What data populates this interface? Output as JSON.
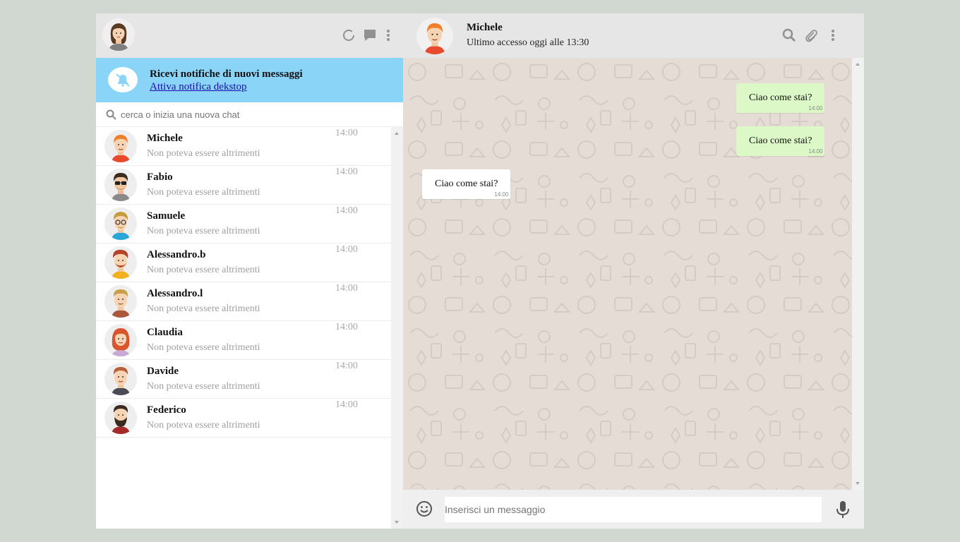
{
  "left_header": {
    "icons": [
      "status-icon",
      "new-chat-icon",
      "menu-icon"
    ]
  },
  "notification": {
    "title": "Ricevi notifiche di nuovi messaggi",
    "link": "Attiva notifica dekstop"
  },
  "search": {
    "placeholder": "cerca o inizia una nuova chat"
  },
  "chats": [
    {
      "name": "Michele",
      "preview": "Non poteva essere altrimenti",
      "time": "14:00"
    },
    {
      "name": "Fabio",
      "preview": "Non poteva essere altrimenti",
      "time": "14:00"
    },
    {
      "name": "Samuele",
      "preview": "Non poteva essere altrimenti",
      "time": "14:00"
    },
    {
      "name": "Alessandro.b",
      "preview": "Non poteva essere altrimenti",
      "time": "14:00"
    },
    {
      "name": "Alessandro.l",
      "preview": "Non poteva essere altrimenti",
      "time": "14:00"
    },
    {
      "name": "Claudia",
      "preview": "Non poteva essere altrimenti",
      "time": "14:00"
    },
    {
      "name": "Davide",
      "preview": "Non poteva essere altrimenti",
      "time": "14:00"
    },
    {
      "name": "Federico",
      "preview": "Non poteva essere altrimenti",
      "time": "14:00"
    }
  ],
  "conversation": {
    "contact_name": "Michele",
    "last_seen": "Ultimo accesso oggi alle 13:30",
    "header_icons": [
      "search-icon",
      "attach-icon",
      "menu-icon"
    ],
    "messages": [
      {
        "direction": "out",
        "text": "Ciao come stai?",
        "time": "14:00"
      },
      {
        "direction": "out",
        "text": "Ciao come stai?",
        "time": "14:00"
      },
      {
        "direction": "in",
        "text": "Ciao come stai?",
        "time": "14:00"
      }
    ]
  },
  "composer": {
    "placeholder": "Inserisci un messaggio"
  },
  "colors": {
    "page_bg": "#d1d7d1",
    "header_bg": "#e6e6e6",
    "notification_bg": "#8ad4f8",
    "outgoing_bubble": "#dcf8c6",
    "incoming_bubble": "#ffffff",
    "chat_bg": "#e5ddd5"
  }
}
